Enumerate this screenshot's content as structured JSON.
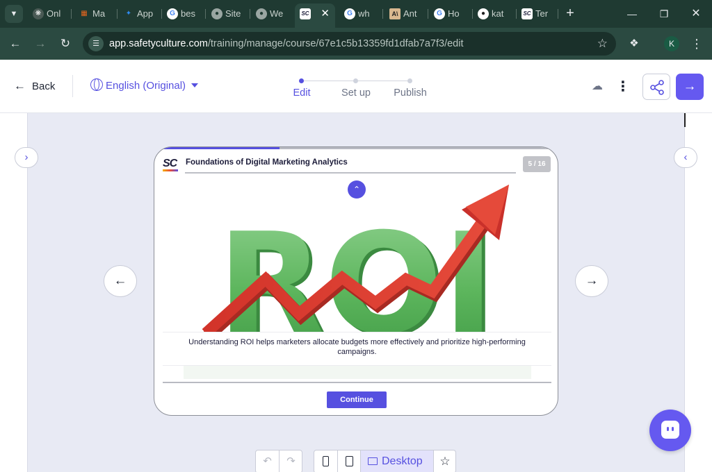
{
  "browser": {
    "tabs": [
      {
        "label": "Onl",
        "favicon": "pin",
        "color": "#c9d2ce"
      },
      {
        "label": "Ma",
        "favicon": "blocks",
        "color": "#e7661e"
      },
      {
        "label": "App",
        "favicon": "butterfly",
        "color": "#2e8bf0"
      },
      {
        "label": "bes",
        "favicon": "google",
        "color": "#ffffff"
      },
      {
        "label": "Site",
        "favicon": "globe",
        "color": "#c9d2ce"
      },
      {
        "label": "We",
        "favicon": "globe",
        "color": "#c9d2ce"
      },
      {
        "label": "",
        "favicon": "safetyculture",
        "color": "#ffffff",
        "active": true
      },
      {
        "label": "wh",
        "favicon": "google",
        "color": "#ffffff"
      },
      {
        "label": "Ant",
        "favicon": "anthropic",
        "color": "#d9b88f"
      },
      {
        "label": "Ho",
        "favicon": "google",
        "color": "#ffffff"
      },
      {
        "label": "kat",
        "favicon": "github",
        "color": "#ffffff"
      },
      {
        "label": "Ter",
        "favicon": "safetyculture",
        "color": "#ffffff"
      }
    ],
    "url_host": "app.safetyculture.com",
    "url_path": "/training/manage/course/67e1c5b13359fd1dfab7a7f3/edit",
    "profile_initial": "K"
  },
  "header": {
    "back_label": "Back",
    "language_label": "English (Original)",
    "steps": [
      {
        "label": "Edit",
        "active": true
      },
      {
        "label": "Set up",
        "active": false
      },
      {
        "label": "Publish",
        "active": false
      }
    ]
  },
  "course": {
    "logo_text": "SC",
    "title": "Foundations of Digital Marketing Analytics",
    "page_indicator": "5 / 16",
    "progress": 0.31,
    "image_word": "ROI",
    "caption": "Understanding ROI helps marketers allocate budgets more effectively and prioritize high-performing campaigns.",
    "continue_label": "Continue"
  },
  "toolbar": {
    "desktop_label": "Desktop"
  },
  "colors": {
    "accent": "#5650e0",
    "browser_frame": "#1f3a32",
    "canvas": "#e8eaf4"
  }
}
